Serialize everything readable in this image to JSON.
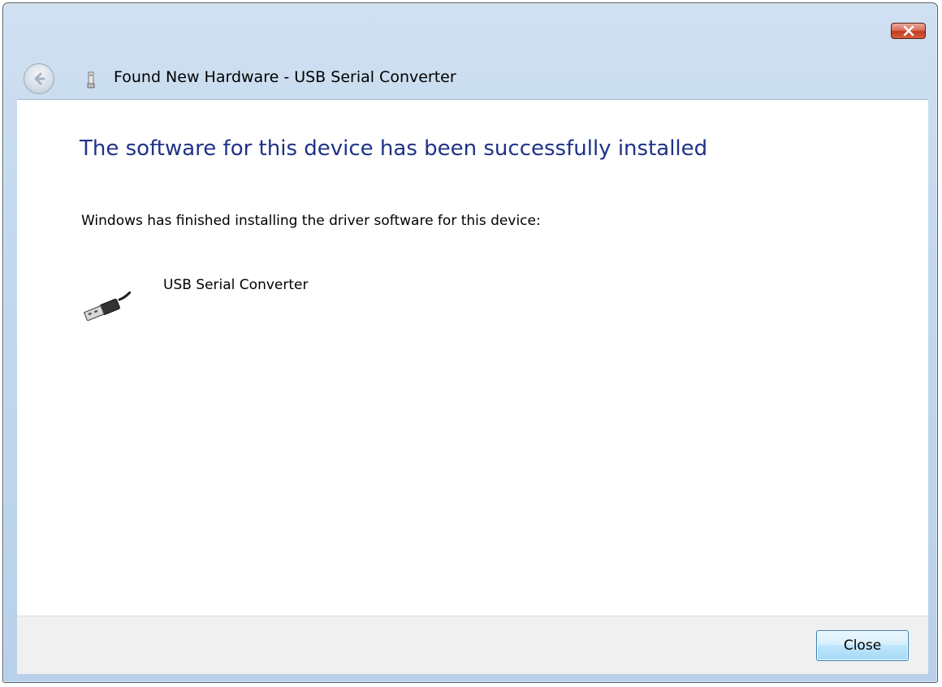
{
  "window": {
    "title": "Found New Hardware - USB Serial Converter",
    "close_icon": "close-icon",
    "back_icon": "back-arrow-icon",
    "hardware_icon": "usb-plug-small-icon"
  },
  "content": {
    "heading": "The software for this device has been successfully installed",
    "description": "Windows has finished installing the driver software for this device:",
    "device": {
      "name": "USB Serial Converter",
      "icon": "usb-cable-icon"
    }
  },
  "footer": {
    "close_label": "Close"
  },
  "colors": {
    "heading": "#1e3287",
    "frame": "#c2d8ee",
    "close_button_accent": "#c3391f"
  }
}
